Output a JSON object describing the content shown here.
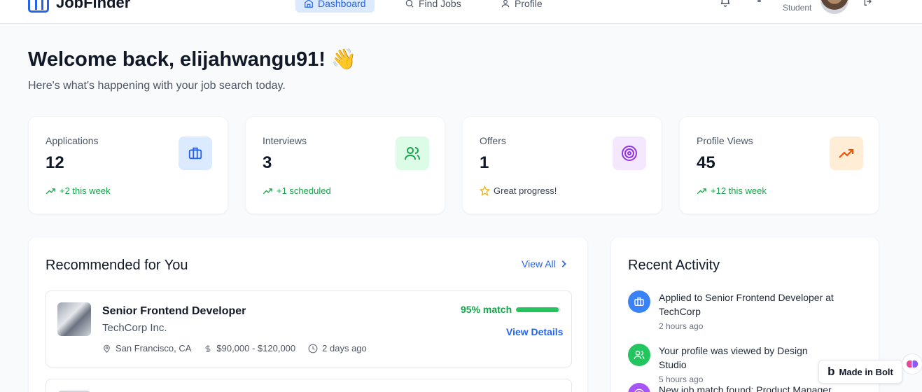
{
  "app": {
    "name": "JobFinder"
  },
  "nav": {
    "dashboard": "Dashboard",
    "find_jobs": "Find Jobs",
    "profile": "Profile"
  },
  "user": {
    "role": "Student"
  },
  "welcome": {
    "title": "Welcome back, elijahwangu91! 👋",
    "subtitle": "Here's what's happening with your job search today."
  },
  "stats": [
    {
      "label": "Applications",
      "value": "12",
      "trend": "+2 this week",
      "icon": "briefcase-icon",
      "color": "#2563eb"
    },
    {
      "label": "Interviews",
      "value": "3",
      "trend": "+1 scheduled",
      "icon": "users-icon",
      "color": "#16a34a"
    },
    {
      "label": "Offers",
      "value": "1",
      "trend": "Great progress!",
      "icon": "target-icon",
      "color": "#9333ea"
    },
    {
      "label": "Profile Views",
      "value": "45",
      "trend": "+12 this week",
      "icon": "trending-up-icon",
      "color": "#ea580c"
    }
  ],
  "recommended": {
    "title": "Recommended for You",
    "view_all": "View All",
    "jobs": [
      {
        "title": "Senior Frontend Developer",
        "company": "TechCorp Inc.",
        "location": "San Francisco, CA",
        "salary": "$90,000 - $120,000",
        "posted": "2 days ago",
        "match": "95% match",
        "match_fraction": 0.95,
        "details": "View Details"
      }
    ]
  },
  "activity": {
    "title": "Recent Activity",
    "items": [
      {
        "text": "Applied to Senior Frontend Developer at TechCorp",
        "time": "2 hours ago",
        "color": "#3b82f6",
        "icon": "briefcase-icon"
      },
      {
        "text": "Your profile was viewed by Design Studio",
        "time": "5 hours ago",
        "color": "#22c55e",
        "icon": "users-icon"
      },
      {
        "text": "New job match found: Product Manager at",
        "time": "",
        "color": "#a855f7",
        "icon": "target-icon"
      }
    ]
  },
  "badge": {
    "label": "Made in Bolt"
  }
}
